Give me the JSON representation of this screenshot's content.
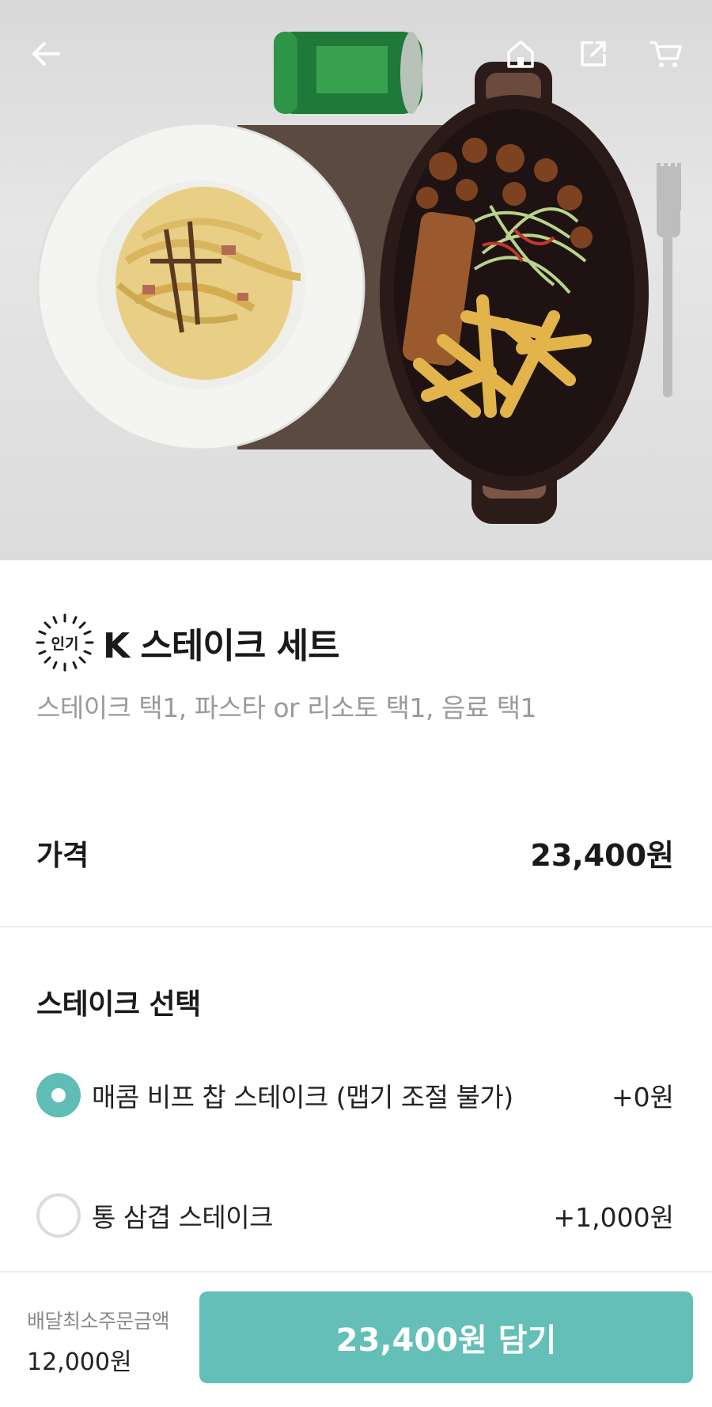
{
  "header": {
    "back_icon": "arrow-left-icon",
    "home_icon": "home-icon",
    "share_icon": "share-icon",
    "cart_icon": "cart-icon"
  },
  "hero": {
    "image": "food-photo: carbonara pasta plate, pork belly steak with fries in cast iron dish, green soda can, fork"
  },
  "menu": {
    "badge": "인기",
    "title": "K 스테이크 세트",
    "description": "스테이크 택1, 파스타 or 리소토 택1, 음료 택1"
  },
  "price": {
    "label": "가격",
    "value": "23,400원"
  },
  "steak_section": {
    "title": "스테이크 선택",
    "options": [
      {
        "label": "매콤 비프 찹 스테이크 (맵기 조절 불가)",
        "price": "+0원",
        "selected": true
      },
      {
        "label": "통 삼겹 스테이크",
        "price": "+1,000원",
        "selected": false
      }
    ]
  },
  "bottom_bar": {
    "min_order_label": "배달최소주문금액",
    "min_order_value": "12,000원",
    "add_button_label": "23,400원 담기"
  },
  "colors": {
    "accent": "#63bfb7",
    "muted_text": "#9a9a9a",
    "divider": "#ececec"
  }
}
